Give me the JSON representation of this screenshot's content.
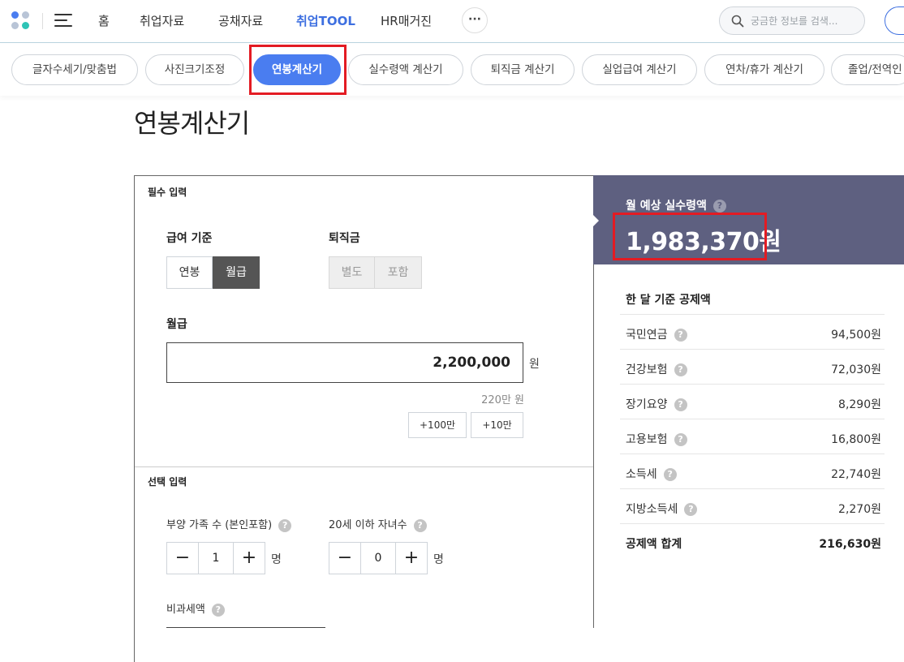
{
  "nav": {
    "links": [
      "홈",
      "취업자료",
      "공채자료",
      "취업TOOL",
      "HR매거진"
    ],
    "active": "취업TOOL",
    "more_label": "···",
    "search_placeholder": "궁금한 정보를 검색..."
  },
  "tabs": [
    "글자수세기/맞춤법",
    "사진크기조정",
    "연봉계산기",
    "실수령액 계산기",
    "퇴직금 계산기",
    "실업급여 계산기",
    "연차/휴가 계산기",
    "졸업/전역인"
  ],
  "active_tab": "연봉계산기",
  "page": {
    "title": "연봉계산기"
  },
  "required": {
    "section_label": "필수 입력",
    "salary_basis": {
      "label": "급여 기준",
      "options": [
        "연봉",
        "월급"
      ],
      "selected": "월급"
    },
    "severance": {
      "label": "퇴직금",
      "options": [
        "별도",
        "포함"
      ]
    },
    "amount": {
      "label": "월급",
      "value": "2,200,000",
      "unit": "원",
      "hint": "220만 원"
    },
    "quick_add": [
      "+100만",
      "+10만"
    ]
  },
  "optional": {
    "section_label": "선택 입력",
    "dependents": {
      "label": "부양 가족 수 (본인포함)",
      "value": "1",
      "unit": "명"
    },
    "children": {
      "label": "20세 이하 자녀수",
      "value": "0",
      "unit": "명"
    },
    "nontaxable": {
      "label": "비과세액"
    }
  },
  "result": {
    "label": "월 예상 실수령액",
    "value": "1,983,370원",
    "deductions_title": "한 달 기준 공제액",
    "deductions": [
      {
        "name": "국민연금",
        "amount": "94,500원"
      },
      {
        "name": "건강보험",
        "amount": "72,030원"
      },
      {
        "name": "장기요양",
        "amount": "8,290원"
      },
      {
        "name": "고용보험",
        "amount": "16,800원"
      },
      {
        "name": "소득세",
        "amount": "22,740원"
      },
      {
        "name": "지방소득세",
        "amount": "2,270원"
      }
    ],
    "total": {
      "name": "공제액 합계",
      "amount": "216,630원"
    }
  },
  "colors": {
    "accent": "#4a7df0",
    "result_bg": "#5e6080",
    "highlight": "#e31b23"
  }
}
